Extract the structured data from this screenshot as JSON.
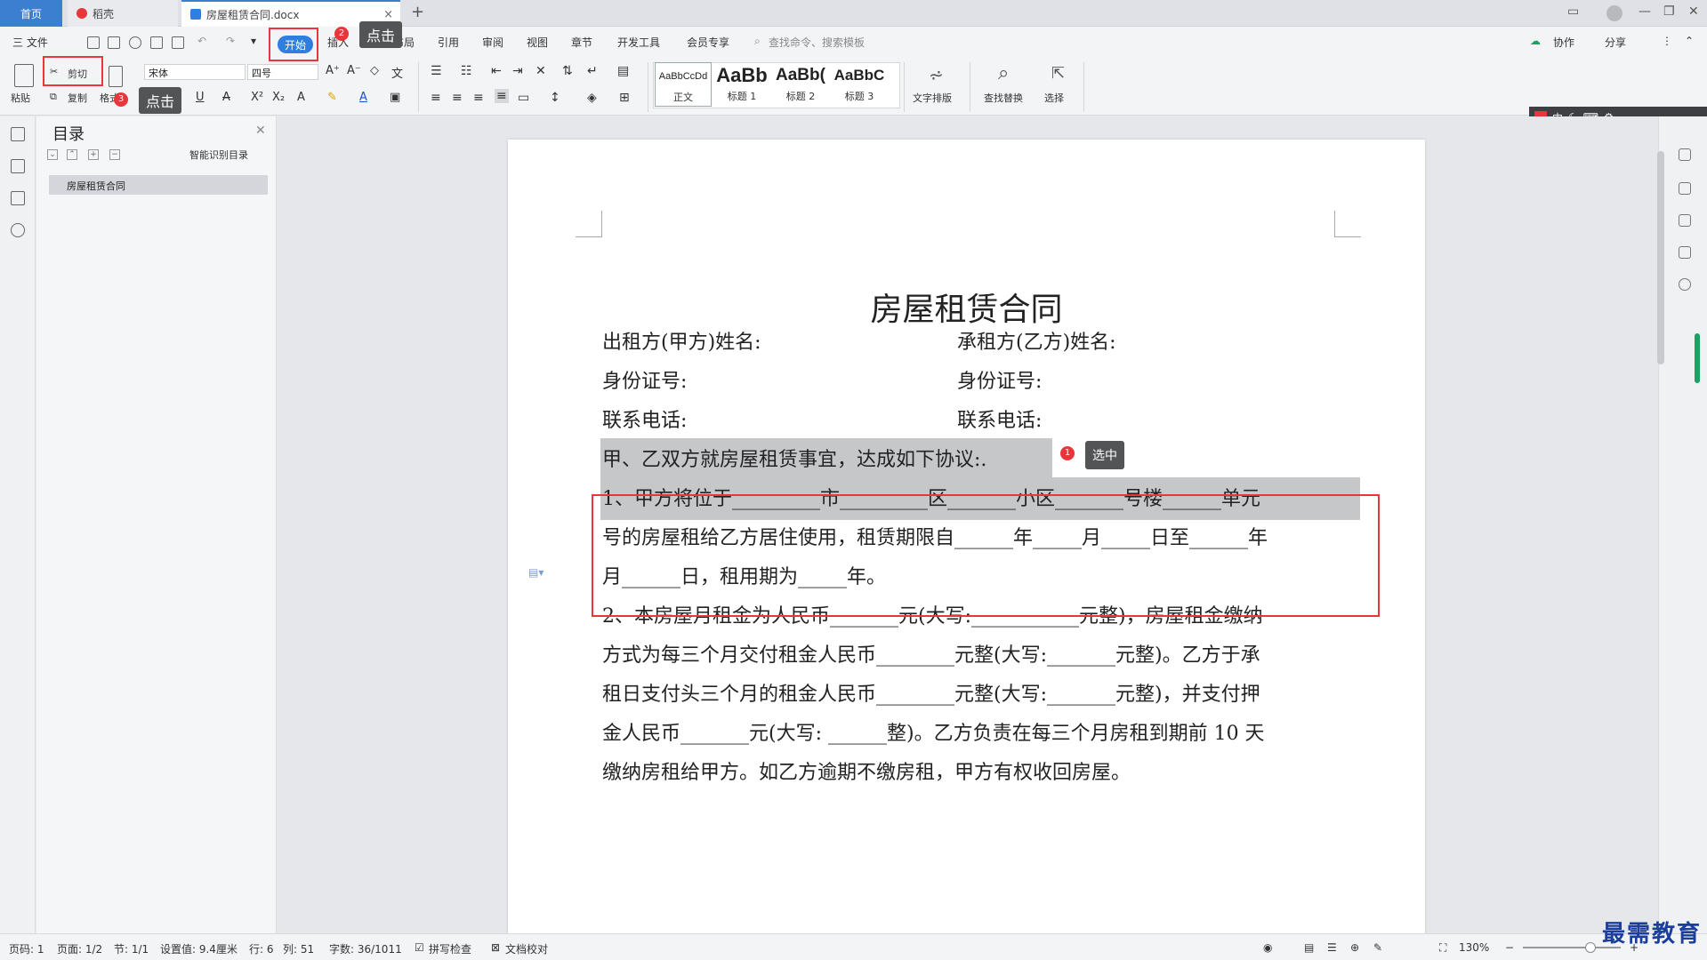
{
  "tabs": {
    "home": "首页",
    "draft": "稻壳",
    "doc": "房屋租赁合同.docx",
    "close": "×",
    "add": "+"
  },
  "menu": {
    "file": "三 文件",
    "start": "开始",
    "insert": "插入",
    "page_layout": "页面布局",
    "reference": "引用",
    "review": "审阅",
    "view": "视图",
    "section": "章节",
    "devtools": "开发工具",
    "member": "会员专享",
    "search_placeholder": "查找命令、搜索模板",
    "collab": "协作",
    "share": "分享"
  },
  "ribbon": {
    "paste": "粘贴",
    "cut": "剪切",
    "copy": "复制",
    "format_painter": "格式",
    "font_name": "宋体",
    "font_size": "四号",
    "styles": [
      {
        "preview": "AaBbCcDd",
        "label": "正文"
      },
      {
        "preview": "AaBb",
        "label": "标题 1"
      },
      {
        "preview": "AaBb(",
        "label": "标题 2"
      },
      {
        "preview": "AaBbC",
        "label": "标题 3"
      }
    ],
    "text_layout": "文字排版",
    "find_replace": "查找替换",
    "select": "选择"
  },
  "callouts": {
    "c1_num": "1",
    "c1_text": "选中",
    "c2_num": "2",
    "c2_text": "点击",
    "c3_num": "3",
    "c3_text": "点击"
  },
  "toc": {
    "title": "目录",
    "smart": "智能识别目录",
    "item": "房屋租赁合同"
  },
  "ime": "中",
  "document": {
    "title": "房屋租赁合同",
    "lessor_name": "出租方(甲方)姓名:",
    "lessee_name": "承租方(乙方)姓名:",
    "id_left": "身份证号:",
    "id_right": "身份证号:",
    "phone_left": "联系电话:",
    "phone_right": "联系电话:",
    "line1": "甲、乙双方就房屋租赁事宜，达成如下协议:.",
    "line2": "1、甲方将位于_________市_________区_______小区_______号楼______单元",
    "line3": "号的房屋租给乙方居住使用，租赁期限自______年_____月_____日至______年",
    "line4": "月______日，租用期为_____年。",
    "line5": "2、本房屋月租金为人民币_______元(大写:___________元整)，房屋租金缴纳",
    "line6": "方式为每三个月交付租金人民币________元整(大写:_______元整)。乙方于承",
    "line7": "租日支付头三个月的租金人民币________元整(大写:_______元整)，并支付押",
    "line8": "金人民币_______元(大写: ______整)。乙方负责在每三个月房租到期前 10 天",
    "line9": "缴纳房租给甲方。如乙方逾期不缴房租，甲方有权收回房屋。"
  },
  "status": {
    "page_code": "页码: 1",
    "pages": "页面: 1/2",
    "section": "节: 1/1",
    "setting": "设置值: 9.4厘米",
    "row": "行: 6",
    "col": "列: 51",
    "words": "字数: 36/1011",
    "spell": "拼写检查",
    "proof": "文档校对",
    "zoom": "130%"
  },
  "watermark": "最需教育"
}
